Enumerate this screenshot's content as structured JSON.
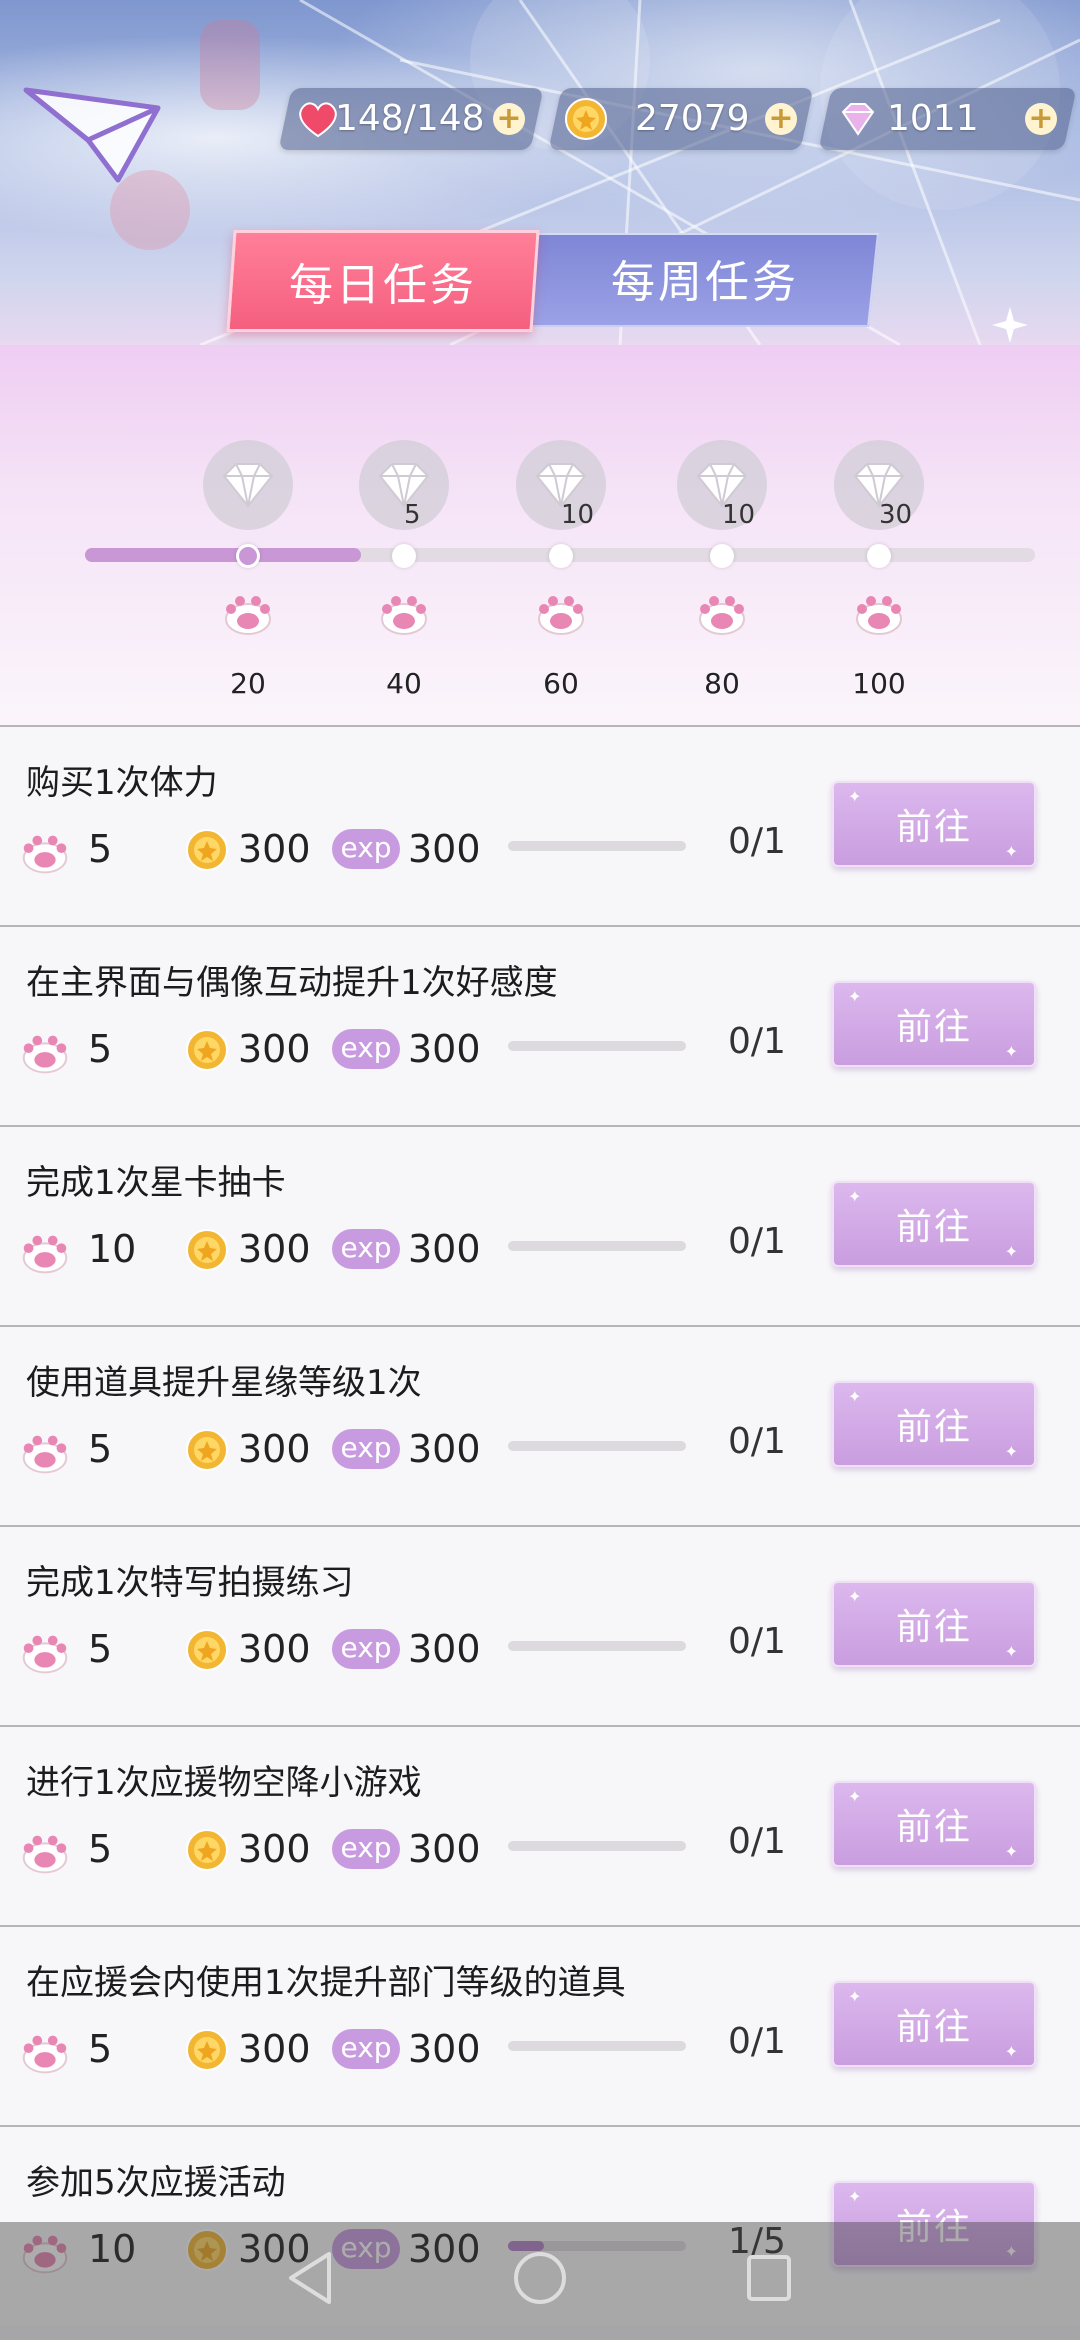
{
  "header": {
    "resources": {
      "stamina": {
        "value": "148/148",
        "icon": "heart-icon",
        "color": "#f04a6a"
      },
      "coins": {
        "value": "27079",
        "icon": "coin-icon",
        "color": "#f2b632"
      },
      "diamonds": {
        "value": "1011",
        "icon": "diamond-icon",
        "color": "#e8a6e6"
      }
    },
    "tabs": {
      "daily": "每日任务",
      "weekly": "每周任务"
    }
  },
  "track": {
    "progress": 0.29,
    "milestones": [
      {
        "points": "20",
        "gems": "",
        "reached": true
      },
      {
        "points": "40",
        "gems": "5",
        "reached": false
      },
      {
        "points": "60",
        "gems": "10",
        "reached": false
      },
      {
        "points": "80",
        "gems": "10",
        "reached": false
      },
      {
        "points": "100",
        "gems": "30",
        "reached": false
      }
    ]
  },
  "tasks": [
    {
      "title": "购买1次体力",
      "paw": "5",
      "coin": "300",
      "exp": "300",
      "progress": "0/1",
      "ratio": 0,
      "button": "前往"
    },
    {
      "title": "在主界面与偶像互动提升1次好感度",
      "paw": "5",
      "coin": "300",
      "exp": "300",
      "progress": "0/1",
      "ratio": 0,
      "button": "前往"
    },
    {
      "title": "完成1次星卡抽卡",
      "paw": "10",
      "coin": "300",
      "exp": "300",
      "progress": "0/1",
      "ratio": 0,
      "button": "前往"
    },
    {
      "title": "使用道具提升星缘等级1次",
      "paw": "5",
      "coin": "300",
      "exp": "300",
      "progress": "0/1",
      "ratio": 0,
      "button": "前往"
    },
    {
      "title": "完成1次特写拍摄练习",
      "paw": "5",
      "coin": "300",
      "exp": "300",
      "progress": "0/1",
      "ratio": 0,
      "button": "前往"
    },
    {
      "title": "进行1次应援物空降小游戏",
      "paw": "5",
      "coin": "300",
      "exp": "300",
      "progress": "0/1",
      "ratio": 0,
      "button": "前往"
    },
    {
      "title": "在应援会内使用1次提升部门等级的道具",
      "paw": "5",
      "coin": "300",
      "exp": "300",
      "progress": "0/1",
      "ratio": 0,
      "button": "前往"
    },
    {
      "title": "参加5次应援活动",
      "paw": "10",
      "coin": "300",
      "exp": "300",
      "progress": "1/5",
      "ratio": 0.2,
      "button": "前往"
    }
  ],
  "exp_label": "exp",
  "colors": {
    "accent_pink": "#f55f80",
    "accent_purple": "#c99ddf",
    "weekly_tab": "#8b92dd"
  }
}
